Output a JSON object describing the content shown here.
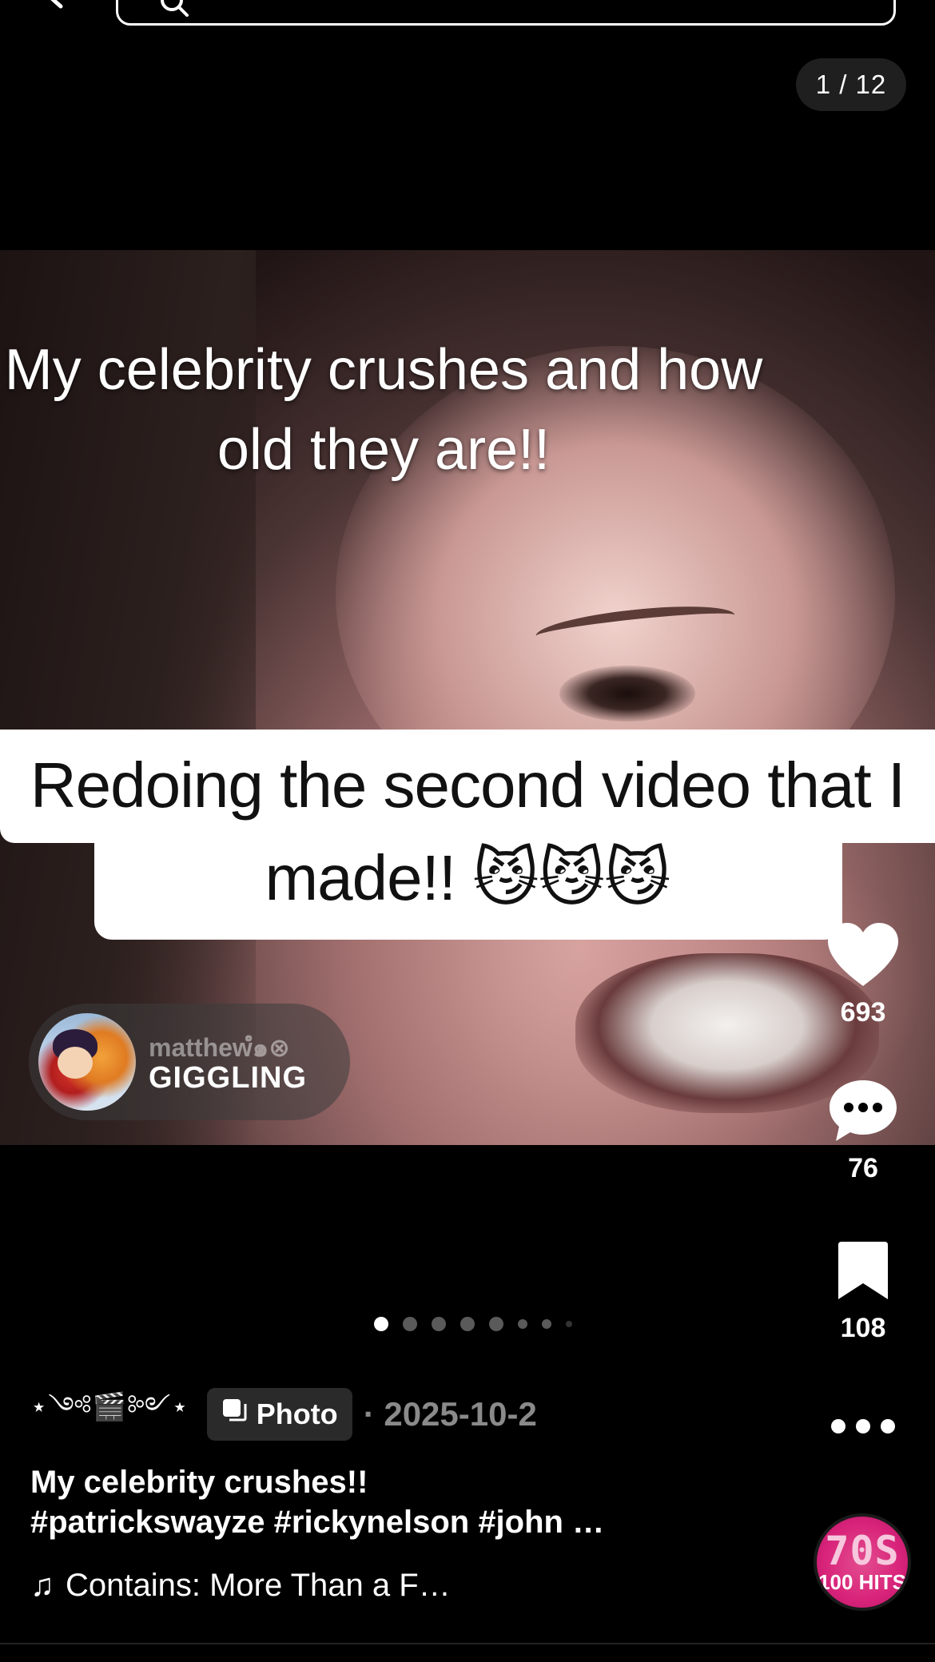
{
  "header": {
    "counter": "1 / 12"
  },
  "photo": {
    "top_caption": "My celebrity crushes and how old they are!!",
    "main_caption": "Redoing the second video that I made!! 😼😼😼"
  },
  "sound": {
    "user": "matthewํ๑⊗",
    "title": "GIGGLING"
  },
  "actions": {
    "likes": "693",
    "comments": "76",
    "saves": "108"
  },
  "carousel": {
    "dots": [
      {
        "state": "active"
      },
      {
        "state": "normal"
      },
      {
        "state": "normal"
      },
      {
        "state": "normal"
      },
      {
        "state": "normal"
      },
      {
        "state": "small"
      },
      {
        "state": "small"
      },
      {
        "state": "tiny"
      }
    ]
  },
  "post": {
    "author": "⋆༺🎬༻⋆",
    "badge_label": "Photo",
    "date": "· 2025-10-2",
    "description_line1": "My celebrity crushes!!",
    "description_line2": "#patrickswayze #rickynelson #john …",
    "music": "Contains: More Than a F…"
  },
  "disc": {
    "line1": "70S",
    "line2": "100 HITS"
  },
  "colors": {
    "background": "#000000",
    "disc": "#d8237a",
    "badge_bg": "#2a2a2a",
    "date": "#8a8a8a"
  }
}
